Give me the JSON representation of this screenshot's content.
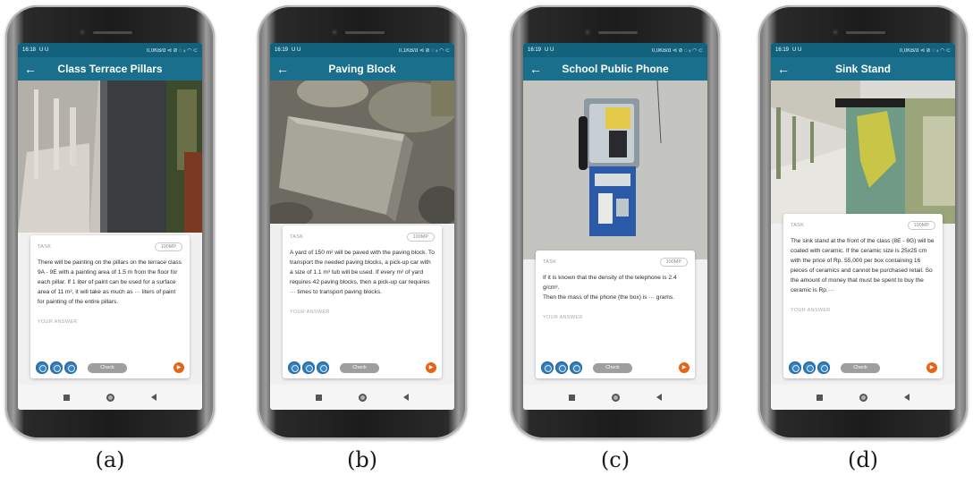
{
  "panels": [
    {
      "caption": "(a)",
      "time": "16:18",
      "status_icons": "U U",
      "network": "0,0KB/d ⊲ ⊘ ◌ ᵢₗ ◠ ⊂",
      "title": "Class Terrace Pillars",
      "task_label": "TASK",
      "badge": "100MP",
      "text": "There will be painting on the pillars on the terrace class 9A - 9E with a painting area of 1.5 m from the floor for each pillar. If 1 liter of paint can be used for a surface area of 11 m², it will take as much as ··· liters of paint for painting of the entire pillars.",
      "answer_label": "YOUR ANSWER",
      "check": "Check"
    },
    {
      "caption": "(b)",
      "time": "16:19",
      "status_icons": "U U",
      "network": "0,1KB/d ⊲ ⊘ ◌ ᵢₗ ◠ ⊂",
      "title": "Paving Block",
      "task_label": "TASK",
      "badge": "100MP",
      "text": "A yard of 150 m² will be paved with the paving block. To transport the needed paving blocks, a pick-up car with a size of 1.1 m³ tub will be used. If every m² of yard requires 42 paving blocks, then a pick-up car requires ··· times to transport paving blocks.",
      "answer_label": "YOUR ANSWER",
      "check": "Check"
    },
    {
      "caption": "(c)",
      "time": "16:19",
      "status_icons": "U U",
      "network": "0,0KB/d ⊲ ⊘ ◌ ᵢₗ ◠ ⊂",
      "title": "School Public Phone",
      "task_label": "TASK",
      "badge": "100MP",
      "text": "If it is known that the density of the telephone is 2.4 g/cm³.\nThen the mass of the phone (the box) is ··· grams.",
      "answer_label": "YOUR ANSWER",
      "check": "Check"
    },
    {
      "caption": "(d)",
      "time": "16:19",
      "status_icons": "U U",
      "network": "0,0KB/d ⊲ ⊘ ◌ ᵢₗ ◠ ⊂",
      "title": "Sink Stand",
      "task_label": "TASK",
      "badge": "100MP",
      "text": "The sink stand at the front of the class (8E - 8G) will be coated with ceramic. If the ceramic size is 25x25 cm with the price of Rp. 55,000 per box containing 16 pieces of ceramics and cannot be purchased retail. So the amount of money that must be spent to buy the ceramic is Rp.···",
      "answer_label": "YOUR ANSWER",
      "check": "Check"
    }
  ],
  "colors": {
    "appbar": "#1a6f8c",
    "statusbar": "#12627d",
    "hint_button": "#3a86c4",
    "skip_button": "#e8631a",
    "check_button": "#9e9e9e"
  },
  "icons": {
    "back": "arrow-left-icon",
    "hint": "lightbulb-icon",
    "skip": "skip-forward-icon",
    "nav_recents": "square-icon",
    "nav_home": "circle-icon",
    "nav_back": "triangle-back-icon"
  }
}
